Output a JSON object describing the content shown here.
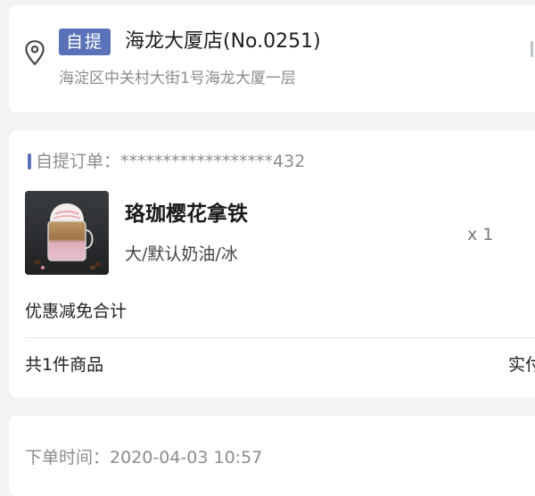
{
  "store": {
    "pickup_badge": "自提",
    "name": "海龙大厦店(No.0251)",
    "address": "海淀区中关村大街1号海龙大厦一层"
  },
  "order": {
    "label_prefix": "自提订单：",
    "number_masked": "******************432",
    "item": {
      "name": "珞珈樱花拿铁",
      "spec": "大/默认奶油/冰",
      "quantity": "x 1"
    },
    "discount_label": "优惠减免合计",
    "item_count": "共1件商品",
    "paid_label_partial": "实付"
  },
  "order_time": {
    "label": "下单时间：",
    "value": "2020-04-03 10:57"
  },
  "colors": {
    "accent": "#5a73b8",
    "background": "#f2f3f5",
    "card": "#ffffff",
    "muted_text": "#8a8c90"
  },
  "icons": {
    "store_location": "map-pin-icon",
    "product": "latte-product-image"
  }
}
